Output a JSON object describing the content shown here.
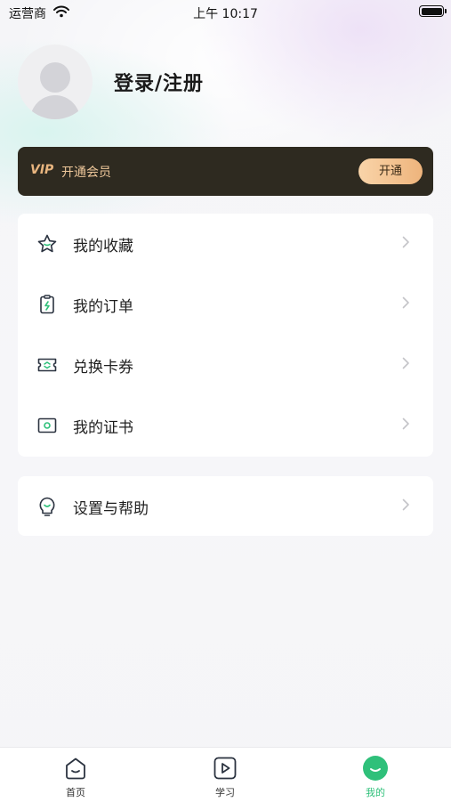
{
  "status_bar": {
    "carrier": "运营商",
    "time": "上午 10:17"
  },
  "profile": {
    "login_label": "登录/注册"
  },
  "vip": {
    "tag": "VIP",
    "text": "开通会员",
    "button": "开通"
  },
  "menu_group_1": [
    {
      "label": "我的收藏",
      "icon": "star-icon"
    },
    {
      "label": "我的订单",
      "icon": "order-clipboard-icon"
    },
    {
      "label": "兑换卡券",
      "icon": "coupon-icon"
    },
    {
      "label": "我的证书",
      "icon": "certificate-icon"
    }
  ],
  "menu_group_2": [
    {
      "label": "设置与帮助",
      "icon": "help-bulb-icon"
    }
  ],
  "tabs": [
    {
      "label": "首页",
      "icon": "home-icon",
      "active": false
    },
    {
      "label": "学习",
      "icon": "play-icon",
      "active": false
    },
    {
      "label": "我的",
      "icon": "profile-face-icon",
      "active": true
    }
  ],
  "colors": {
    "accent": "#2fc07a",
    "vip_bg": "#2e2a20",
    "vip_gold": "#eec79a"
  }
}
